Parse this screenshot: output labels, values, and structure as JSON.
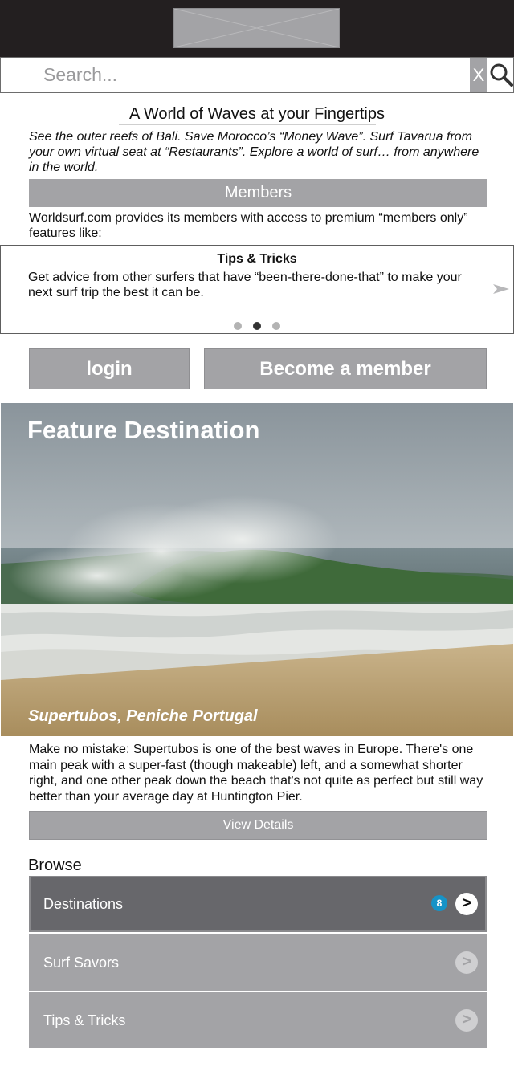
{
  "search": {
    "placeholder": "Search...",
    "clear_label": "X",
    "icon": "magnifier-icon"
  },
  "logo": {
    "icon": "image-placeholder-icon"
  },
  "intro": {
    "headline": "A World of Waves at your Fingertips",
    "tagline": "See the outer reefs of Bali. Save Morocco’s “Money Wave”.  Surf Tavarua from your own virtual seat at “Restaurants”. Explore a world of surf… from anywhere in the world."
  },
  "members": {
    "heading": "Members",
    "text": "Worldsurf.com provides its members with access to premium “members only” features like:"
  },
  "carousel": {
    "title": "Tips & Tricks",
    "body": "Get advice from other surfers that have “been-there-done-that” to make your next surf trip the best it can be.",
    "next_icon": "arrow-right-icon",
    "slides": 3,
    "active_slide": 2
  },
  "auth": {
    "login_label": "login",
    "join_label": "Become a member"
  },
  "feature": {
    "title": "Feature Destination",
    "caption": "Supertubos, Peniche Portugal",
    "description": "Make no mistake: Supertubos is one of the best waves in Europe. There's one main peak with a super-fast (though makeable) left, and a somewhat shorter right, and one other peak down the beach that's not quite as perfect but still way better than your average day at Huntington Pier.",
    "details_label": "View Details"
  },
  "browse": {
    "heading": "Browse",
    "items": [
      {
        "label": "Destinations",
        "badge": "8",
        "chevron": ">"
      },
      {
        "label": "Surf Savors",
        "chevron": ">"
      },
      {
        "label": "Tips & Tricks",
        "chevron": ">"
      }
    ]
  },
  "colors": {
    "header": "#231f20",
    "button_gray": "#a3a3a6",
    "active_item": "#67676b",
    "badge": "#1793c7"
  }
}
